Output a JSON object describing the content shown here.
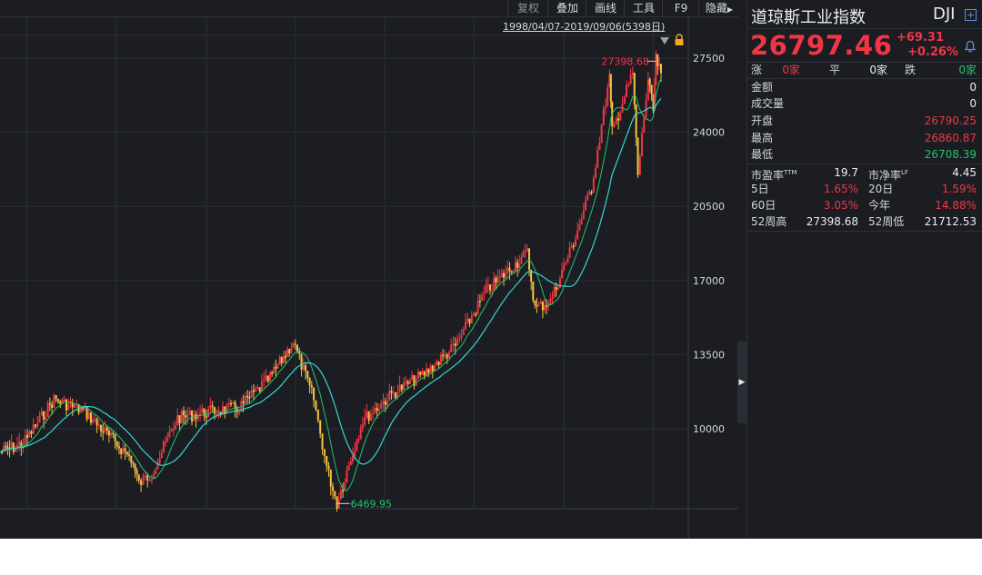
{
  "toolbar": {
    "fuquan": "复权",
    "diejia": "叠加",
    "huaxian": "画线",
    "gongju": "工具",
    "f9": "F9",
    "yincang": "隐藏"
  },
  "chart": {
    "range_label": "1998/04/07-2019/09/06(5398日)",
    "high_marker": "27398.68",
    "low_marker": "6469.95",
    "y_ticks": [
      "27500",
      "24000",
      "20500",
      "17000",
      "13500",
      "10000"
    ],
    "colors": {
      "up": "#f23645",
      "down": "#f5c542",
      "ma_short": "#25c26e",
      "ma_long": "#36d6cf"
    }
  },
  "chart_data": {
    "type": "line",
    "title": "",
    "xlabel": "",
    "ylabel": "",
    "x": [
      "1998-04",
      "1999-01",
      "2000-01",
      "2001-01",
      "2002-07",
      "2002-10",
      "2003-03",
      "2004-01",
      "2005-01",
      "2006-01",
      "2007-01",
      "2007-10",
      "2008-06",
      "2008-11",
      "2009-03",
      "2010-01",
      "2011-01",
      "2012-01",
      "2013-01",
      "2014-01",
      "2015-05",
      "2015-08",
      "2016-02",
      "2016-11",
      "2017-06",
      "2018-01",
      "2018-02",
      "2018-10",
      "2018-12",
      "2019-04",
      "2019-06",
      "2019-07",
      "2019-09"
    ],
    "series": [
      {
        "values": [
          8900,
          9300,
          11400,
          10800,
          8600,
          7400,
          7900,
          10500,
          10800,
          11000,
          12400,
          14100,
          11400,
          8200,
          6470,
          10400,
          11700,
          12600,
          13900,
          16500,
          18300,
          15700,
          16000,
          18800,
          21400,
          26600,
          24000,
          26800,
          22000,
          26500,
          25000,
          27390,
          26797
        ]
      }
    ],
    "ylim": [
      6400,
      27800
    ],
    "ticks": [
      27500,
      24000,
      20500,
      17000,
      13500,
      10000
    ],
    "annotations": [
      {
        "label": "27398.68",
        "x": "2019-07",
        "y": 27398.68
      },
      {
        "label": "6469.95",
        "x": "2009-03",
        "y": 6469.95
      }
    ]
  },
  "panel": {
    "name": "道琼斯工业指数",
    "code": "DJI",
    "price": "26797.46",
    "change": "+69.31",
    "change_pct": "+0.26%",
    "zhang_label": "涨",
    "zhang_value": "0家",
    "ping_label": "平",
    "ping_value": "0家",
    "die_label": "跌",
    "die_value": "0家",
    "stats": [
      {
        "label": "金额",
        "value": "0"
      },
      {
        "label": "成交量",
        "value": "0"
      },
      {
        "label": "开盘",
        "value": "26790.25"
      },
      {
        "label": "最高",
        "value": "26860.87"
      },
      {
        "label": "最低",
        "value": "26708.39"
      }
    ],
    "pe_label": "市盈率",
    "pe_sup": "TTM",
    "pe_value": "19.7",
    "pb_label": "市净率",
    "pb_sup": "LF",
    "pb_value": "4.45",
    "d5_label": "5日",
    "d5_value": "1.65%",
    "d20_label": "20日",
    "d20_value": "1.59%",
    "d60_label": "60日",
    "d60_value": "3.05%",
    "ytd_label": "今年",
    "ytd_value": "14.88%",
    "w52h_label": "52周高",
    "w52h_value": "27398.68",
    "w52l_label": "52周低",
    "w52l_value": "21712.53"
  }
}
